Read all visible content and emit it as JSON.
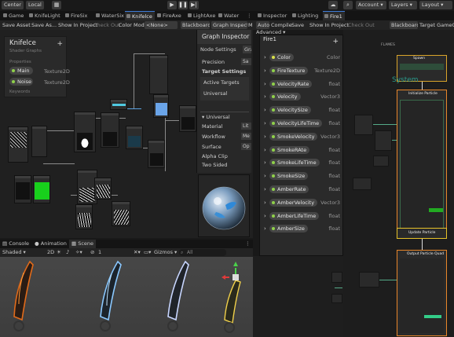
{
  "toolbar": {
    "center": "Center",
    "local": "Local",
    "account": "Account",
    "layers": "Layers",
    "layout": "Layout",
    "play_icon": "play-icon",
    "pause_icon": "pause-icon",
    "step_icon": "step-icon"
  },
  "left_tabs": [
    {
      "label": "Game"
    },
    {
      "label": "KnifeLight"
    },
    {
      "label": "FireSix"
    },
    {
      "label": "WaterSix"
    },
    {
      "label": "Knifelce",
      "active": true
    },
    {
      "label": "FireAxe"
    },
    {
      "label": "LightAxe"
    },
    {
      "label": "Water"
    }
  ],
  "right_tabs": [
    {
      "label": "Inspector"
    },
    {
      "label": "Lighting"
    },
    {
      "label": "Fire1",
      "active": true
    }
  ],
  "left_subbar": {
    "save_asset": "Save Asset",
    "save_as": "Save As...",
    "show_in_project": "Show In Project",
    "check_out": "Check Out",
    "color_mode_label": "Color Mode",
    "color_mode_value": "<None>",
    "blackboard": "Blackboard",
    "graph_inspector": "Graph Inspector",
    "overflow": "M"
  },
  "right_subbar": {
    "auto": "Auto",
    "compile": "Compile",
    "save": "Save",
    "show_in_project": "Show In Project",
    "check_out": "Check Out",
    "blackboard": "Blackboard",
    "target_gameobject": "Target GameObje"
  },
  "blackboard": {
    "title": "Knifelce",
    "subtitle": "Shader Graphs",
    "properties_label": "Properties",
    "keywords_label": "Keywords",
    "properties": [
      {
        "name": "Main",
        "type": "Texture2D"
      },
      {
        "name": "Noise",
        "type": "Texture2D"
      }
    ]
  },
  "graph_inspector": {
    "title": "Graph Inspector",
    "tab_node_settings": "Node Settings",
    "tab_graph": "Grap",
    "precision_label": "Precision",
    "precision_value": "Sa",
    "target_settings": "Target Settings",
    "active_targets": "Active Targets",
    "universal": "Universal",
    "universal_header": "Universal",
    "material_label": "Material",
    "material_value": "Lit",
    "workflow_label": "Workflow",
    "workflow_value": "Me",
    "surface_label": "Surface",
    "surface_value": "Op",
    "alpha_clip": "Alpha Clip",
    "two_sided": "Two Sided"
  },
  "vfx_blackboard": {
    "title": "Fire1",
    "advanced": "Advanced",
    "properties": [
      {
        "name": "Color",
        "type": "Color",
        "color": "#d8e04a"
      },
      {
        "name": "FireTexture",
        "type": "Texture2D",
        "color": "#8fd04a"
      },
      {
        "name": "VelocityRate",
        "type": "float",
        "color": "#8fd04a"
      },
      {
        "name": "Velocity",
        "type": "Vector3",
        "color": "#8fd04a"
      },
      {
        "name": "VelocitySize",
        "type": "float",
        "color": "#8fd04a"
      },
      {
        "name": "VelocityLifeTime",
        "type": "float",
        "color": "#8fd04a"
      },
      {
        "name": "SmokeVelocity",
        "type": "Vector3",
        "color": "#8fd04a"
      },
      {
        "name": "SmokeRAte",
        "type": "float",
        "color": "#8fd04a"
      },
      {
        "name": "SmokeLifeTime",
        "type": "float",
        "color": "#8fd04a"
      },
      {
        "name": "SmokeSize",
        "type": "float",
        "color": "#8fd04a"
      },
      {
        "name": "AmberRate",
        "type": "float",
        "color": "#8fd04a"
      },
      {
        "name": "AmberVelocity",
        "type": "Vector3",
        "color": "#8fd04a"
      },
      {
        "name": "AmberLifeTime",
        "type": "float",
        "color": "#8fd04a"
      },
      {
        "name": "AmberSize",
        "type": "float",
        "color": "#8fd04a"
      }
    ]
  },
  "vfx_graph": {
    "label_flames": "FLAMES",
    "label_system": "System",
    "label_spawn": "Spawn",
    "label_initialize": "Initialize Particle",
    "label_update": "Update Particle",
    "label_output": "Output Particle Quad"
  },
  "bottom_tabs": [
    {
      "label": "Console"
    },
    {
      "label": "Animation"
    },
    {
      "label": "Scene",
      "active": true
    }
  ],
  "scene_toolbar": {
    "shading": "Shaded",
    "mode_2d": "2D",
    "gizmos": "Gizmos",
    "search_placeholder": "All",
    "layer_count": "1"
  },
  "colors": {
    "accent": "#3d7bd8",
    "vfx_orange": "#e8862a",
    "vfx_yellow": "#e6c229",
    "vfx_green": "#38b65a",
    "property_dot": "#8fd04a",
    "color_dot": "#d8e04a"
  }
}
